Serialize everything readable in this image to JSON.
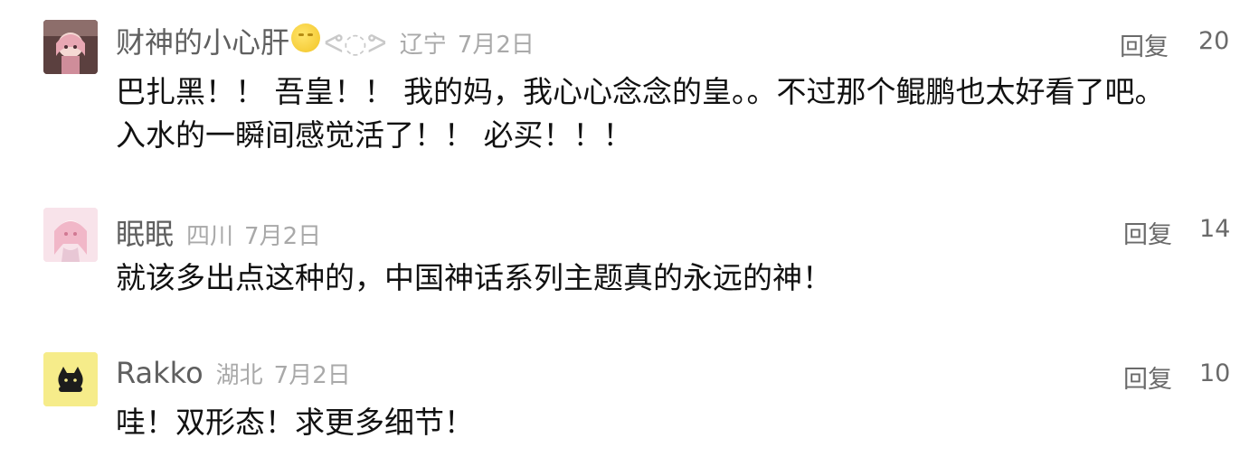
{
  "comments": [
    {
      "username": "财神的小心肝",
      "emoji_suffix": "ᕙ◌ᕗ",
      "location": "辽宁",
      "date": "7月2日",
      "reply_label": "回复",
      "likes": "20",
      "avatar": "anime-girl-avatar",
      "lines": [
        "巴扎黑！！ 吾皇！！ 我的妈，我心心念念的皇。。不过那个鲲鹏也太好看了吧。",
        "入水的一瞬间感觉活了！！ 必买！！！"
      ]
    },
    {
      "username": "眠眠",
      "location": "四川",
      "date": "7月2日",
      "reply_label": "回复",
      "likes": "14",
      "avatar": "pink-anime-avatar",
      "lines": [
        "就该多出点这种的，中国神话系列主题真的永远的神！"
      ]
    },
    {
      "username": "Rakko",
      "location": "湖北",
      "date": "7月2日",
      "reply_label": "回复",
      "likes": "10",
      "avatar": "black-cat-avatar",
      "lines": [
        "哇！双形态！求更多细节！"
      ]
    }
  ],
  "colors": {
    "username": "#5f5f5f",
    "meta": "#a9a9a9",
    "body": "#111111",
    "avatar3_bg": "#f6ec8a"
  }
}
